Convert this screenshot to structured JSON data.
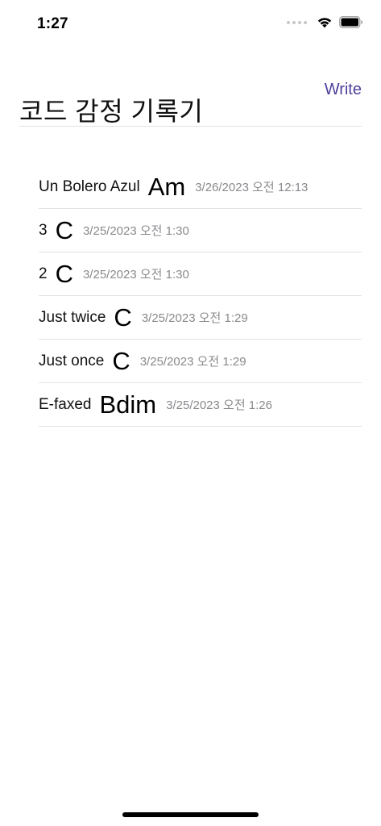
{
  "status_bar": {
    "time": "1:27",
    "icons": [
      "signal-dots-icon",
      "wifi-icon",
      "battery-icon"
    ]
  },
  "header": {
    "title": "코드 감정 기록기",
    "write_label": "Write"
  },
  "colors": {
    "accent": "#4b3f9a",
    "date_text": "#8a8a8e",
    "divider": "#e2e2e2"
  },
  "entries": [
    {
      "title": "Un Bolero Azul",
      "chord": "Am",
      "date": "3/26/2023 오전 12:13"
    },
    {
      "title": "3",
      "chord": "C",
      "date": "3/25/2023 오전 1:30"
    },
    {
      "title": "2",
      "chord": "C",
      "date": "3/25/2023 오전 1:30"
    },
    {
      "title": "Just twice",
      "chord": "C",
      "date": "3/25/2023 오전 1:29"
    },
    {
      "title": "Just once",
      "chord": "C",
      "date": "3/25/2023 오전 1:29"
    },
    {
      "title": "E-faxed",
      "chord": "Bdim",
      "date": "3/25/2023 오전 1:26"
    }
  ]
}
